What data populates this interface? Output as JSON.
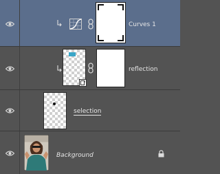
{
  "layers": [
    {
      "name": "Curves 1",
      "type": "adjustment",
      "selected": true,
      "clipped": true,
      "icon": "curves-adjustment-icon"
    },
    {
      "name": "reflection",
      "type": "pixel-with-mask",
      "selected": false,
      "clipped": true
    },
    {
      "name": "selection",
      "type": "pixel",
      "selected": false,
      "clipped": false
    },
    {
      "name": "Background",
      "type": "background",
      "selected": false,
      "locked": true
    }
  ],
  "colors": {
    "panel_bg": "#535353",
    "selected_bg": "#5b6e8c",
    "text": "#e6e6e6",
    "divider": "#3a3a3a"
  }
}
